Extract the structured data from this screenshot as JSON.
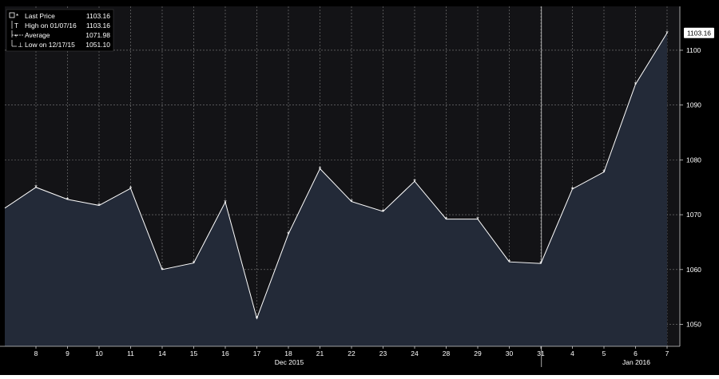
{
  "legend": {
    "rows": [
      {
        "label": "Last Price",
        "value": "1103.16",
        "icon": "box-star-icon"
      },
      {
        "label": "High on 01/07/16",
        "value": "1103.16",
        "icon": "high-marker-icon"
      },
      {
        "label": "Average",
        "value": "1071.98",
        "icon": "average-line-icon"
      },
      {
        "label": "Low on 12/17/15",
        "value": "1051.10",
        "icon": "low-marker-icon"
      }
    ]
  },
  "last_price_tag": "1103.16",
  "month_labels": [
    {
      "text": "Dec 2015",
      "center_index": 8
    },
    {
      "text": "Jan 2016",
      "center_index": 19
    }
  ],
  "colors": {
    "plot_bg": "#131316",
    "area_fill": "#232a38",
    "line": "#ffffff",
    "grid": "#9a9a9a",
    "axis_text": "#ffffff",
    "frame_bg": "#000000"
  },
  "chart_data": {
    "type": "area",
    "x": [
      "8",
      "9",
      "10",
      "11",
      "14",
      "15",
      "16",
      "17",
      "18",
      "21",
      "22",
      "23",
      "24",
      "28",
      "29",
      "30",
      "31",
      "4",
      "5",
      "6",
      "7"
    ],
    "y": [
      1075.0,
      1072.8,
      1071.7,
      1074.8,
      1060.0,
      1061.2,
      1072.3,
      1051.1,
      1066.5,
      1078.4,
      1072.4,
      1070.6,
      1076.1,
      1069.2,
      1069.2,
      1061.4,
      1061.1,
      1074.7,
      1077.8,
      1093.8,
      1103.16
    ],
    "y_at_left_edge": 1071.2,
    "y_ticks": [
      1050,
      1060,
      1070,
      1080,
      1090,
      1100
    ],
    "ylim": [
      1046,
      1108
    ],
    "series": [
      {
        "name": "Last Price"
      }
    ],
    "grid": true,
    "legend_position": "top-left",
    "x_groups": [
      "Dec 2015",
      "Jan 2016"
    ]
  }
}
